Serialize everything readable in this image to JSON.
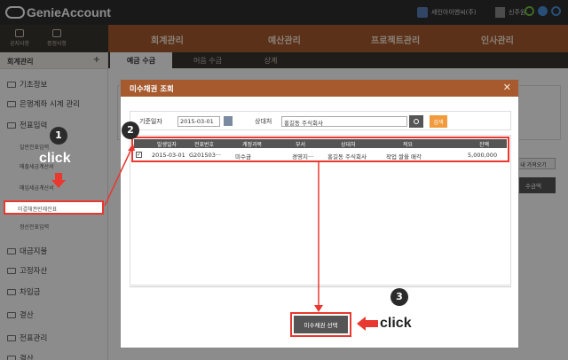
{
  "app": {
    "name": "GenieAccount"
  },
  "topbar": {
    "company": "세인아이엔씨(주)",
    "user": "신주원"
  },
  "quick_links": [
    "공지사항",
    "증정사항"
  ],
  "main_menu": [
    "회계관리",
    "예산관리",
    "프로젝트관리",
    "인사관리"
  ],
  "sidebar": {
    "title": "회계관리",
    "items": [
      "기초정보",
      "은행계좌 시계 관리",
      "전표입력",
      "대금지불",
      "고정자산",
      "차입금",
      "결산",
      "전표관리",
      "결산"
    ],
    "sub_items": [
      "일반전표입력",
      "매출세금계산서",
      "매입세금계산서",
      "미결채권반제전표",
      "정산전표입력"
    ]
  },
  "tabs": [
    "예금 수금",
    "어음 수금",
    "상계"
  ],
  "background": {
    "btn_fetch": "내 가져오기",
    "btn_amount": "수금액"
  },
  "modal": {
    "title": "미수채권 조회",
    "date_label": "기준일자",
    "date_value": "2015-03-01",
    "customer_label": "상대처",
    "customer_value": "홍길동 주식회사",
    "search_btn": "검색",
    "columns": [
      "발생일자",
      "전표번호",
      "계정과목",
      "부서",
      "상대처",
      "적요",
      "잔액"
    ],
    "rows": [
      [
        "2015-03-01",
        "G201503···",
        "미수금",
        "경영지···",
        "홍길동 주식회사",
        "작업 쌀을 매각",
        "5,000,000"
      ]
    ],
    "select_btn": "미수채권 선택"
  },
  "annotations": {
    "badges": [
      "1",
      "2",
      "3"
    ],
    "click": "click"
  },
  "colors": {
    "accent": "#a65a2e",
    "highlight": "#e8382f",
    "dark": "#2e2e2e"
  }
}
